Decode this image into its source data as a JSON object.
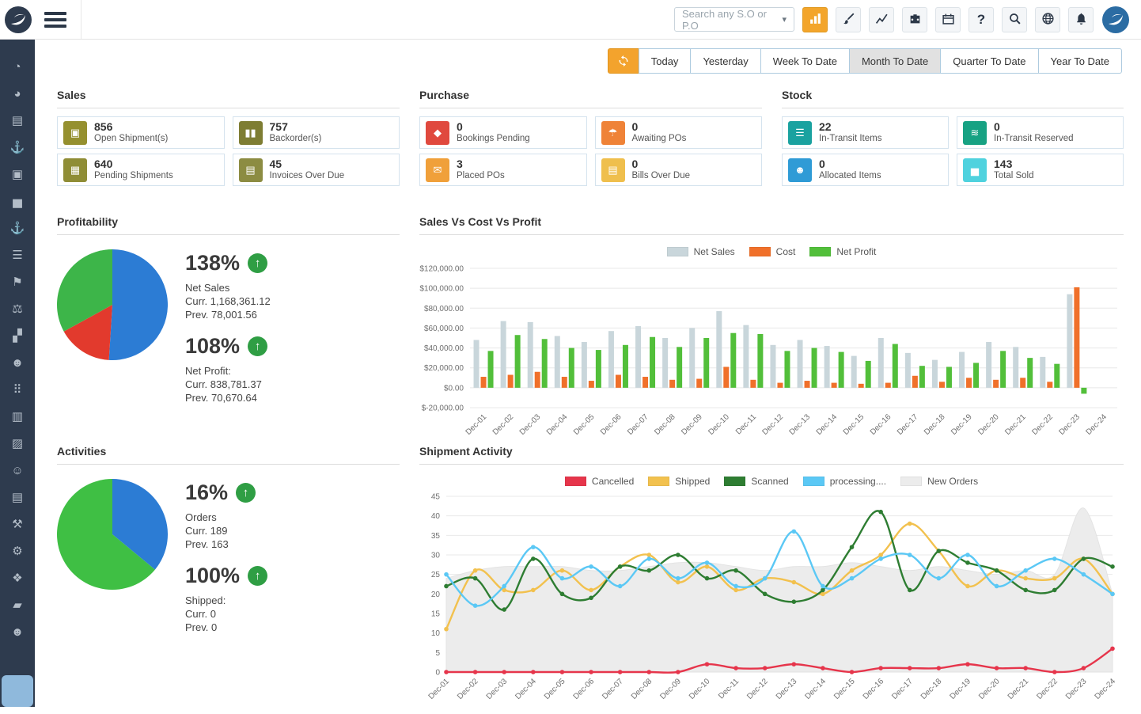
{
  "topbar": {
    "search": {
      "placeholder": "Search any S.O or P.O"
    },
    "buttons": [
      {
        "name": "bar-chart",
        "active": true
      },
      {
        "name": "paint-brush",
        "active": false
      },
      {
        "name": "line-chart",
        "active": false
      },
      {
        "name": "briefcase",
        "active": false
      },
      {
        "name": "calendar",
        "active": false
      },
      {
        "name": "help",
        "active": false
      },
      {
        "name": "search",
        "active": false
      },
      {
        "name": "globe",
        "active": false
      },
      {
        "name": "bell",
        "active": false
      }
    ]
  },
  "date_filter": {
    "tabs": [
      "Today",
      "Yesterday",
      "Week To Date",
      "Month To Date",
      "Quarter To Date",
      "Year To Date"
    ],
    "active": "Month To Date"
  },
  "sidebar": {
    "items": [
      {
        "name": "dashboard-icon",
        "glyph": "◔"
      },
      {
        "name": "performance-icon",
        "glyph": "◕"
      },
      {
        "name": "invoices-icon",
        "glyph": "▤"
      },
      {
        "name": "shipments-icon",
        "glyph": "⚓"
      },
      {
        "name": "packages-icon",
        "glyph": "▣"
      },
      {
        "name": "sales-stats-icon",
        "glyph": "▅"
      },
      {
        "name": "outbound-icon",
        "glyph": "⚓"
      },
      {
        "name": "orders-icon",
        "glyph": "☰"
      },
      {
        "name": "delivery-icon",
        "glyph": "⚑"
      },
      {
        "name": "balance-icon",
        "glyph": "⚖"
      },
      {
        "name": "analytics-icon",
        "glyph": "▞"
      },
      {
        "name": "partners-icon",
        "glyph": "☻"
      },
      {
        "name": "apps-icon",
        "glyph": "⠿"
      },
      {
        "name": "documents-icon",
        "glyph": "▥"
      },
      {
        "name": "copies-icon",
        "glyph": "▨"
      },
      {
        "name": "contacts-icon",
        "glyph": "☺"
      },
      {
        "name": "bills-icon",
        "glyph": "▤"
      },
      {
        "name": "tools-icon",
        "glyph": "⚒"
      },
      {
        "name": "settings-icon",
        "glyph": "⚙"
      },
      {
        "name": "layers-icon",
        "glyph": "❖"
      },
      {
        "name": "folders-icon",
        "glyph": "▰"
      },
      {
        "name": "team-icon",
        "glyph": "☻"
      }
    ]
  },
  "kpi_sections": [
    {
      "title": "Sales",
      "cards": [
        {
          "value": "856",
          "label": "Open Shipment(s)",
          "color": "#95902f",
          "icon": "box",
          "glyph": "▣"
        },
        {
          "value": "757",
          "label": "Backorder(s)",
          "color": "#7e7d33",
          "icon": "pause",
          "glyph": "▮▮"
        },
        {
          "value": "640",
          "label": "Pending Shipments",
          "color": "#8f8d36",
          "icon": "calendar",
          "glyph": "▦"
        },
        {
          "value": "45",
          "label": "Invoices Over Due",
          "color": "#8c8c42",
          "icon": "file",
          "glyph": "▤"
        }
      ]
    },
    {
      "title": "Purchase",
      "cards": [
        {
          "value": "0",
          "label": "Bookings Pending",
          "color": "#e0493e",
          "icon": "bag",
          "glyph": "◆"
        },
        {
          "value": "0",
          "label": "Awaiting POs",
          "color": "#ef8338",
          "icon": "umbrella",
          "glyph": "☂"
        },
        {
          "value": "3",
          "label": "Placed POs",
          "color": "#f0a03a",
          "icon": "envelope",
          "glyph": "✉"
        },
        {
          "value": "0",
          "label": "Bills Over Due",
          "color": "#efbf4d",
          "icon": "file",
          "glyph": "▤"
        }
      ]
    },
    {
      "title": "Stock",
      "cards": [
        {
          "value": "22",
          "label": "In-Transit Items",
          "color": "#1aa2a0",
          "icon": "lines",
          "glyph": "☰"
        },
        {
          "value": "0",
          "label": "In-Transit Reserved",
          "color": "#17a283",
          "icon": "waves",
          "glyph": "≋"
        },
        {
          "value": "0",
          "label": "Allocated Items",
          "color": "#2f9bd6",
          "icon": "people",
          "glyph": "☻"
        },
        {
          "value": "143",
          "label": "Total Sold",
          "color": "#4fd2de",
          "icon": "chart",
          "glyph": "▅"
        }
      ]
    }
  ],
  "profitability": {
    "title": "Profitability",
    "stats": [
      {
        "percent": "138%",
        "trend": "up",
        "lines": [
          "Net Sales",
          "Curr. 1,168,361.12",
          "Prev. 78,001.56"
        ]
      },
      {
        "percent": "108%",
        "trend": "up",
        "lines": [
          "Net Profit:",
          "Curr. 838,781.37",
          "Prev. 70,670.64"
        ]
      }
    ]
  },
  "activities": {
    "title": "Activities",
    "stats": [
      {
        "percent": "16%",
        "trend": "up",
        "lines": [
          "Orders",
          "Curr. 189",
          "Prev. 163"
        ]
      },
      {
        "percent": "100%",
        "trend": "up",
        "lines": [
          "Shipped:",
          "Curr. 0",
          "Prev. 0"
        ]
      }
    ]
  },
  "chart_data": [
    {
      "type": "pie",
      "name": "profitability-breakdown",
      "slices": [
        {
          "label": "net-sales",
          "pct": 51,
          "color": "#2c7cd4"
        },
        {
          "label": "cost",
          "pct": 16,
          "color": "#e23a2d"
        },
        {
          "label": "net-profit",
          "pct": 33,
          "color": "#3db549"
        }
      ]
    },
    {
      "type": "bar",
      "title": "Sales Vs Cost Vs Profit",
      "categories": [
        "Dec-01",
        "Dec-02",
        "Dec-03",
        "Dec-04",
        "Dec-05",
        "Dec-06",
        "Dec-07",
        "Dec-08",
        "Dec-09",
        "Dec-10",
        "Dec-11",
        "Dec-12",
        "Dec-13",
        "Dec-14",
        "Dec-15",
        "Dec-16",
        "Dec-17",
        "Dec-18",
        "Dec-19",
        "Dec-20",
        "Dec-21",
        "Dec-22",
        "Dec-23",
        "Dec-24"
      ],
      "ylim": [
        -20000,
        120000
      ],
      "ytick_step": 20000,
      "series": [
        {
          "name": "Net Sales",
          "color": "#c9d6db",
          "values": [
            48000,
            67000,
            66000,
            52000,
            46000,
            57000,
            62000,
            50000,
            60000,
            77000,
            63000,
            43000,
            48000,
            42000,
            32000,
            50000,
            35000,
            28000,
            36000,
            46000,
            41000,
            31000,
            94000,
            0
          ]
        },
        {
          "name": "Cost",
          "color": "#f0702a",
          "values": [
            11000,
            13000,
            16000,
            11000,
            7000,
            13000,
            11000,
            8000,
            9000,
            21000,
            8000,
            5000,
            7000,
            5000,
            4000,
            5000,
            12000,
            6000,
            10000,
            8000,
            10000,
            6000,
            101000,
            0
          ]
        },
        {
          "name": "Net Profit",
          "color": "#52bf3a",
          "values": [
            37000,
            53000,
            49000,
            40000,
            38000,
            43000,
            51000,
            41000,
            50000,
            55000,
            54000,
            37000,
            40000,
            36000,
            27000,
            44000,
            22000,
            21000,
            25000,
            37000,
            30000,
            24000,
            -6000,
            0
          ]
        }
      ]
    },
    {
      "type": "pie",
      "name": "activities-breakdown",
      "slices": [
        {
          "label": "orders",
          "pct": 36,
          "color": "#2c7cd4"
        },
        {
          "label": "shipped",
          "pct": 64,
          "color": "#3fbf44"
        }
      ]
    },
    {
      "type": "line",
      "title": "Shipment Activity",
      "x": [
        "Dec-01",
        "Dec-02",
        "Dec-03",
        "Dec-04",
        "Dec-05",
        "Dec-06",
        "Dec-07",
        "Dec-08",
        "Dec-09",
        "Dec-10",
        "Dec-11",
        "Dec-12",
        "Dec-13",
        "Dec-14",
        "Dec-15",
        "Dec-16",
        "Dec-17",
        "Dec-18",
        "Dec-19",
        "Dec-20",
        "Dec-21",
        "Dec-22",
        "Dec-23",
        "Dec-24"
      ],
      "ylim": [
        0,
        45
      ],
      "ytick_step": 5,
      "series": [
        {
          "name": "Cancelled",
          "color": "#e6354b",
          "values": [
            0,
            0,
            0,
            0,
            0,
            0,
            0,
            0,
            0,
            2,
            1,
            1,
            2,
            1,
            0,
            1,
            1,
            1,
            2,
            1,
            1,
            0,
            1,
            6
          ]
        },
        {
          "name": "Shipped",
          "color": "#f2c14e",
          "values": [
            11,
            26,
            21,
            21,
            26,
            21,
            27,
            30,
            23,
            27,
            21,
            24,
            23,
            20,
            26,
            30,
            38,
            31,
            22,
            26,
            24,
            24,
            29,
            20
          ]
        },
        {
          "name": "Scanned",
          "color": "#2e7d32",
          "values": [
            22,
            24,
            16,
            29,
            20,
            19,
            27,
            26,
            30,
            24,
            26,
            20,
            18,
            21,
            32,
            41,
            21,
            31,
            28,
            26,
            21,
            21,
            29,
            27
          ]
        },
        {
          "name": "processing....",
          "color": "#5bc8f5",
          "values": [
            25,
            17,
            22,
            32,
            24,
            27,
            22,
            29,
            24,
            28,
            22,
            24,
            36,
            22,
            24,
            29,
            30,
            24,
            30,
            22,
            26,
            29,
            25,
            20
          ]
        },
        {
          "name": "New Orders",
          "color": "#ececec",
          "area": true,
          "values": [
            24,
            26,
            27,
            27,
            27,
            26,
            26,
            27,
            28,
            28,
            27,
            26,
            27,
            27,
            28,
            27,
            26,
            27,
            26,
            25,
            26,
            25,
            42,
            20
          ]
        }
      ]
    }
  ]
}
